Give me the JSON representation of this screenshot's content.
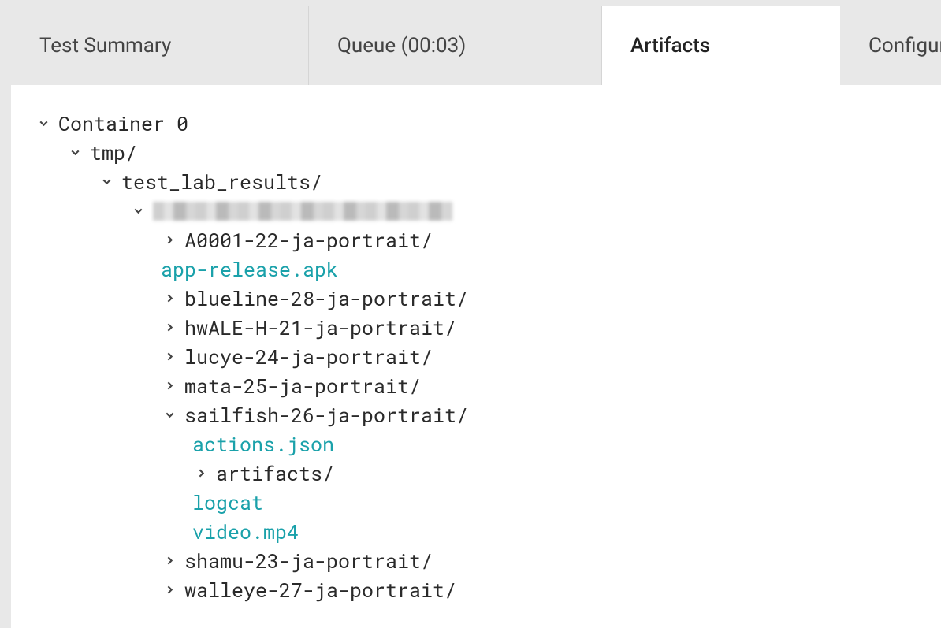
{
  "tabs": {
    "test_summary": "Test Summary",
    "queue": "Queue (00:03)",
    "artifacts": "Artifacts",
    "configuration": "Configur"
  },
  "tree": {
    "container": "Container 0",
    "tmp": "tmp/",
    "test_lab_results": "test_lab_results/",
    "a0001": "A0001-22-ja-portrait/",
    "apk": "app-release.apk",
    "blueline": "blueline-28-ja-portrait/",
    "hwale": "hwALE-H-21-ja-portrait/",
    "lucye": "lucye-24-ja-portrait/",
    "mata": "mata-25-ja-portrait/",
    "sailfish": "sailfish-26-ja-portrait/",
    "actions": "actions.json",
    "artifacts_dir": "artifacts/",
    "logcat": "logcat",
    "video": "video.mp4",
    "shamu": "shamu-23-ja-portrait/",
    "walleye": "walleye-27-ja-portrait/"
  }
}
